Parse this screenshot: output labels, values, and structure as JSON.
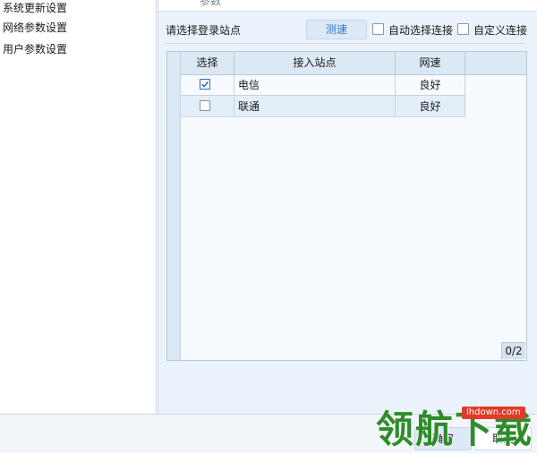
{
  "nav": {
    "items": [
      "系统更新设置",
      "网络参数设置",
      "用户参数设置"
    ]
  },
  "section": {
    "top_partial": "参数",
    "login_label": "请选择登录站点",
    "speed_test": "测速",
    "auto_select": "自动选择连接",
    "custom": "自定义连接"
  },
  "grid": {
    "columns": [
      "选择",
      "接入站点",
      "网速"
    ],
    "rows": [
      {
        "checked": true,
        "site": "电信",
        "speed": "良好"
      },
      {
        "checked": false,
        "site": "联通",
        "speed": "良好"
      }
    ],
    "pager": "0/2"
  },
  "buttons": {
    "ok": "确定",
    "cancel": "取消"
  },
  "watermark": {
    "logo": "领航下载",
    "url": "lhdown.com"
  },
  "colors": {
    "accent": "#3478c6",
    "panel_bg": "#eaf2fb",
    "watermark_green": "#2e8c2a",
    "watermark_red": "#e23a2a"
  }
}
